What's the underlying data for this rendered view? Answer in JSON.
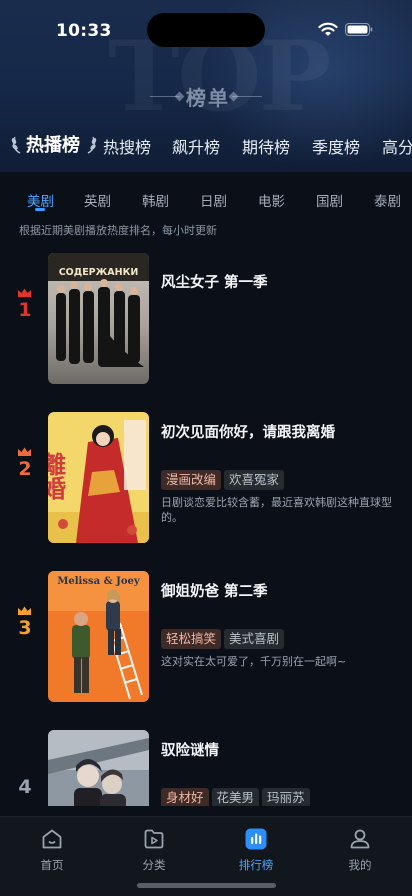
{
  "status_bar": {
    "time": "10:33"
  },
  "header": {
    "watermark": "TOP",
    "title": "榜单"
  },
  "rank_tabs": [
    {
      "label": "热播榜",
      "active": true
    },
    {
      "label": "热搜榜"
    },
    {
      "label": "飙升榜"
    },
    {
      "label": "期待榜"
    },
    {
      "label": "季度榜"
    },
    {
      "label": "高分"
    }
  ],
  "category_tabs": [
    {
      "label": "美剧",
      "active": true
    },
    {
      "label": "英剧"
    },
    {
      "label": "韩剧"
    },
    {
      "label": "日剧"
    },
    {
      "label": "电影"
    },
    {
      "label": "国剧"
    },
    {
      "label": "泰剧"
    }
  ],
  "subtitle": "根据近期美剧播放热度排名，每小时更新",
  "items": [
    {
      "rank": "1",
      "title": "风尘女子 第一季",
      "tags": [],
      "desc": "",
      "poster_text": "СОДЕРЖАНКИ",
      "rank_color": "#e0342f"
    },
    {
      "rank": "2",
      "title": "初次见面你好，请跟我离婚",
      "tags": [
        {
          "label": "漫画改编",
          "hot": true
        },
        {
          "label": "欢喜冤家"
        }
      ],
      "desc": "日剧谈恋爱比较含蓄，最近喜欢韩剧这种直球型的。",
      "poster_text": "離婚",
      "rank_color": "#f06b3a"
    },
    {
      "rank": "3",
      "title": "御姐奶爸 第二季",
      "tags": [
        {
          "label": "轻松搞笑",
          "hot": true
        },
        {
          "label": "美式喜剧"
        }
      ],
      "desc": "这对实在太可爱了，千万别在一起啊~",
      "poster_text": "Melissa & Joey",
      "rank_color": "#f4a22b"
    },
    {
      "rank": "4",
      "title": "驭险谜情",
      "tags": [
        {
          "label": "身材好",
          "hot": true
        },
        {
          "label": "花美男"
        },
        {
          "label": "玛丽苏"
        }
      ],
      "desc": "",
      "poster_text": "",
      "rank_color": "#9aa2ae"
    }
  ],
  "bottom_nav": [
    {
      "label": "首页",
      "icon": "home-icon"
    },
    {
      "label": "分类",
      "icon": "category-icon"
    },
    {
      "label": "排行榜",
      "icon": "ranking-icon",
      "active": true
    },
    {
      "label": "我的",
      "icon": "profile-icon"
    }
  ]
}
